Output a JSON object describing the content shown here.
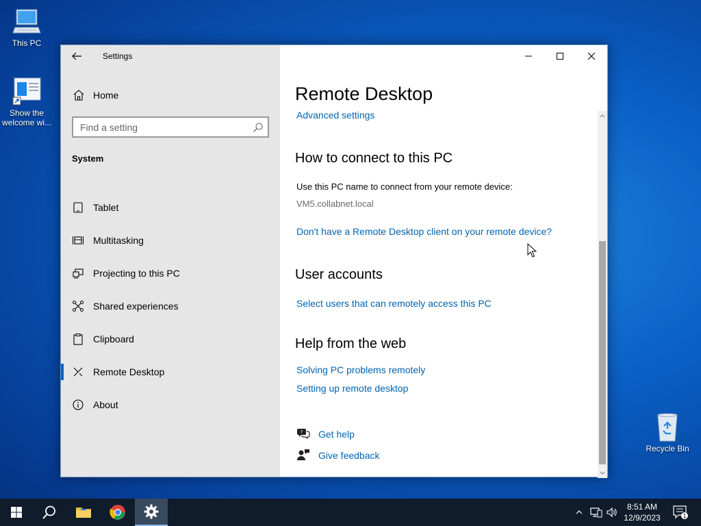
{
  "desktop": {
    "icons": [
      {
        "label": "This PC"
      },
      {
        "label": "Show the welcome wi..."
      },
      {
        "label": "Recycle Bin"
      }
    ]
  },
  "window": {
    "app_title": "Settings",
    "sidebar": {
      "home_label": "Home",
      "search_placeholder": "Find a setting",
      "section_title": "System",
      "items": [
        {
          "label": "Tablet",
          "icon": "tablet-icon"
        },
        {
          "label": "Multitasking",
          "icon": "multitasking-icon"
        },
        {
          "label": "Projecting to this PC",
          "icon": "projecting-icon"
        },
        {
          "label": "Shared experiences",
          "icon": "shared-experiences-icon"
        },
        {
          "label": "Clipboard",
          "icon": "clipboard-icon"
        },
        {
          "label": "Remote Desktop",
          "icon": "remote-desktop-icon",
          "active": true
        },
        {
          "label": "About",
          "icon": "info-icon"
        }
      ]
    },
    "content": {
      "title": "Remote Desktop",
      "advanced_link": "Advanced settings",
      "connect_heading": "How to connect to this PC",
      "connect_text": "Use this PC name to connect from your remote device:",
      "pc_name": "VM5.collabnet.local",
      "client_link": "Don't have a Remote Desktop client on your remote device?",
      "users_heading": "User accounts",
      "users_link": "Select users that can remotely access this PC",
      "help_heading": "Help from the web",
      "help_links": [
        "Solving PC problems remotely",
        "Setting up remote desktop"
      ],
      "get_help": "Get help",
      "give_feedback": "Give feedback"
    }
  },
  "taskbar": {
    "time": "8:51 AM",
    "date": "12/9/2023",
    "notification_count": "1"
  },
  "colors": {
    "accent": "#0067c0",
    "link": "#0063b1",
    "sidebar_bg": "#e6e6e6",
    "taskbar_bg": "#101c2c"
  }
}
